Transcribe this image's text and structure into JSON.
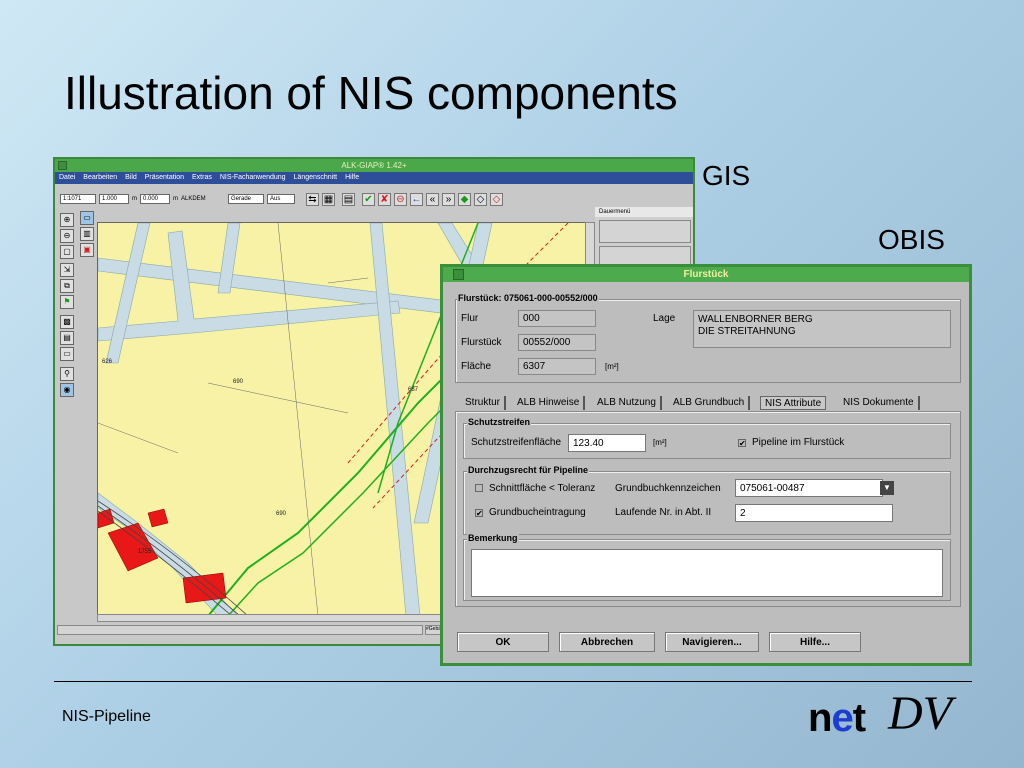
{
  "slide": {
    "title": "Illustration of NIS components",
    "label_gis": "GIS",
    "label_obis": "OBIS",
    "footer": "NIS-Pipeline",
    "logo_net_n": "n",
    "logo_net_e": "e",
    "logo_net_t": "t",
    "logo_dv": "DV"
  },
  "gis": {
    "window_title": "ALK-GIAP® 1.42+",
    "menu": [
      "Datei",
      "Bearbeiten",
      "Bild",
      "Präsentation",
      "Extras",
      "NIS-Fachanwendung",
      "Längenschnitt",
      "Hilfe"
    ],
    "scale": "1:1071",
    "zoom1": "1.000",
    "zoom2": "0.000",
    "unit": "m",
    "layer": "ALKDEM",
    "mode1": "Gerade",
    "mode2": "Aus",
    "panel_header": "Dauermenü",
    "map_labels": [
      "626",
      "690",
      "687",
      "690",
      "1755"
    ],
    "status_right": "#Gebäude"
  },
  "obis": {
    "window_title": "Flurstück",
    "group_title": "Flurstück: 075061-000-00552/000",
    "flur_label": "Flur",
    "flur_value": "000",
    "flurstueck_label": "Flurstück",
    "flurstueck_value": "00552/000",
    "flaeche_label": "Fläche",
    "flaeche_value": "6307",
    "flaeche_unit": "[m²]",
    "lage_label": "Lage",
    "lage_line1": "WALLENBORNER BERG",
    "lage_line2": "DIE STREITAHNUNG",
    "tabs": [
      "Struktur",
      "ALB Hinweise",
      "ALB Nutzung",
      "ALB Grundbuch",
      "NIS Attribute",
      "NIS Dokumente"
    ],
    "schutz_title": "Schutzstreifen",
    "schutz_label": "Schutzstreifenfläche",
    "schutz_value": "123.40",
    "schutz_unit": "[m²]",
    "pipeline_cb": "Pipeline im Flurstück",
    "durch_title": "Durchzugsrecht für Pipeline",
    "schnitt_cb": "Schnittfläche < Toleranz",
    "gbkz_label": "Grundbuchkennzeichen",
    "gbkz_value": "075061-00487",
    "gbe_cb": "Grundbucheintragung",
    "lfd_label": "Laufende Nr. in Abt. II",
    "lfd_value": "2",
    "bemerkung_title": "Bemerkung",
    "buttons": [
      "OK",
      "Abbrechen",
      "Navigieren...",
      "Hilfe..."
    ]
  },
  "colors": {
    "title_bar": "#4daa4d",
    "menu_bar": "#2f4e9a",
    "map_fill": "#f7f2a6",
    "road": "#c9dbe4",
    "building": "#e81818",
    "pipeline": "#1fb01f"
  }
}
